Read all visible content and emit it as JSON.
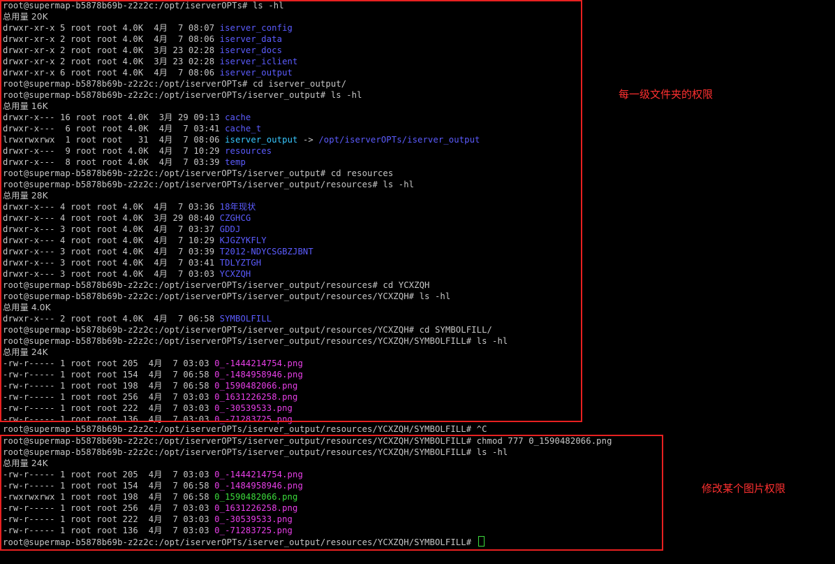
{
  "terminal": {
    "lines": [
      {
        "segs": [
          {
            "t": "root@supermap-b5878b69b-z2z2c:/opt/iserverOPTs# ls -hl"
          }
        ]
      },
      {
        "segs": [
          {
            "t": "总用量 20K",
            "cls": "cjk"
          }
        ]
      },
      {
        "segs": [
          {
            "t": "drwxr-xr-x 5 root root 4.0K  4月  7 08:07 "
          },
          {
            "t": "iserver_config",
            "cls": "dir"
          }
        ]
      },
      {
        "segs": [
          {
            "t": "drwxr-xr-x 2 root root 4.0K  4月  7 08:06 "
          },
          {
            "t": "iserver_data",
            "cls": "dir"
          }
        ]
      },
      {
        "segs": [
          {
            "t": "drwxr-xr-x 2 root root 4.0K  3月 23 02:28 "
          },
          {
            "t": "iserver_docs",
            "cls": "dir"
          }
        ]
      },
      {
        "segs": [
          {
            "t": "drwxr-xr-x 2 root root 4.0K  3月 23 02:28 "
          },
          {
            "t": "iserver_iclient",
            "cls": "dir"
          }
        ]
      },
      {
        "segs": [
          {
            "t": "drwxr-xr-x 6 root root 4.0K  4月  7 08:06 "
          },
          {
            "t": "iserver_output",
            "cls": "dir"
          }
        ]
      },
      {
        "segs": [
          {
            "t": "root@supermap-b5878b69b-z2z2c:/opt/iserverOPTs# cd iserver_output/"
          }
        ]
      },
      {
        "segs": [
          {
            "t": "root@supermap-b5878b69b-z2z2c:/opt/iserverOPTs/iserver_output# ls -hl"
          }
        ]
      },
      {
        "segs": [
          {
            "t": "总用量 16K",
            "cls": "cjk"
          }
        ]
      },
      {
        "segs": [
          {
            "t": "drwxr-x--- 16 root root 4.0K  3月 29 09:13 "
          },
          {
            "t": "cache",
            "cls": "dir"
          }
        ]
      },
      {
        "segs": [
          {
            "t": "drwxr-x---  6 root root 4.0K  4月  7 03:41 "
          },
          {
            "t": "cache_t",
            "cls": "dir"
          }
        ]
      },
      {
        "segs": [
          {
            "t": "lrwxrwxrwx  1 root root   31  4月  7 08:06 "
          },
          {
            "t": "iserver_output",
            "cls": "link"
          },
          {
            "t": " -> "
          },
          {
            "t": "/opt/iserverOPTs/iserver_output",
            "cls": "dir"
          }
        ]
      },
      {
        "segs": [
          {
            "t": "drwxr-x---  9 root root 4.0K  4月  7 10:29 "
          },
          {
            "t": "resources",
            "cls": "dir"
          }
        ]
      },
      {
        "segs": [
          {
            "t": "drwxr-x---  8 root root 4.0K  4月  7 03:39 "
          },
          {
            "t": "temp",
            "cls": "dir"
          }
        ]
      },
      {
        "segs": [
          {
            "t": "root@supermap-b5878b69b-z2z2c:/opt/iserverOPTs/iserver_output# cd resources"
          }
        ]
      },
      {
        "segs": [
          {
            "t": "root@supermap-b5878b69b-z2z2c:/opt/iserverOPTs/iserver_output/resources# ls -hl"
          }
        ]
      },
      {
        "segs": [
          {
            "t": "总用量 28K",
            "cls": "cjk"
          }
        ]
      },
      {
        "segs": [
          {
            "t": "drwxr-x--- 4 root root 4.0K  4月  7 03:36 "
          },
          {
            "t": "18年现状",
            "cls": "dir"
          }
        ]
      },
      {
        "segs": [
          {
            "t": "drwxr-x--- 4 root root 4.0K  3月 29 08:40 "
          },
          {
            "t": "CZGHCG",
            "cls": "dir"
          }
        ]
      },
      {
        "segs": [
          {
            "t": "drwxr-x--- 3 root root 4.0K  4月  7 03:37 "
          },
          {
            "t": "GDDJ",
            "cls": "dir"
          }
        ]
      },
      {
        "segs": [
          {
            "t": "drwxr-x--- 4 root root 4.0K  4月  7 10:29 "
          },
          {
            "t": "KJGZYKFLY",
            "cls": "dir"
          }
        ]
      },
      {
        "segs": [
          {
            "t": "drwxr-x--- 3 root root 4.0K  4月  7 03:39 "
          },
          {
            "t": "T2012-NDYCSGBZJBNT",
            "cls": "dir"
          }
        ]
      },
      {
        "segs": [
          {
            "t": "drwxr-x--- 3 root root 4.0K  4月  7 03:41 "
          },
          {
            "t": "TDLYZTGH",
            "cls": "dir"
          }
        ]
      },
      {
        "segs": [
          {
            "t": "drwxr-x--- 3 root root 4.0K  4月  7 03:03 "
          },
          {
            "t": "YCXZQH",
            "cls": "dir"
          }
        ]
      },
      {
        "segs": [
          {
            "t": "root@supermap-b5878b69b-z2z2c:/opt/iserverOPTs/iserver_output/resources# cd YCXZQH"
          }
        ]
      },
      {
        "segs": [
          {
            "t": "root@supermap-b5878b69b-z2z2c:/opt/iserverOPTs/iserver_output/resources/YCXZQH# ls -hl"
          }
        ]
      },
      {
        "segs": [
          {
            "t": "总用量 4.0K",
            "cls": "cjk"
          }
        ]
      },
      {
        "segs": [
          {
            "t": "drwxr-x--- 2 root root 4.0K  4月  7 06:58 "
          },
          {
            "t": "SYMBOLFILL",
            "cls": "dir"
          }
        ]
      },
      {
        "segs": [
          {
            "t": "root@supermap-b5878b69b-z2z2c:/opt/iserverOPTs/iserver_output/resources/YCXZQH# cd SYMBOLFILL/"
          }
        ]
      },
      {
        "segs": [
          {
            "t": "root@supermap-b5878b69b-z2z2c:/opt/iserverOPTs/iserver_output/resources/YCXZQH/SYMBOLFILL# ls -hl"
          }
        ]
      },
      {
        "segs": [
          {
            "t": "总用量 24K",
            "cls": "cjk"
          }
        ]
      },
      {
        "segs": [
          {
            "t": "-rw-r----- 1 root root 205  4月  7 03:03 "
          },
          {
            "t": "0_-1444214754.png",
            "cls": "pink"
          }
        ]
      },
      {
        "segs": [
          {
            "t": "-rw-r----- 1 root root 154  4月  7 06:58 "
          },
          {
            "t": "0_-1484958946.png",
            "cls": "pink"
          }
        ]
      },
      {
        "segs": [
          {
            "t": "-rw-r----- 1 root root 198  4月  7 06:58 "
          },
          {
            "t": "0_1590482066.png",
            "cls": "pink"
          }
        ]
      },
      {
        "segs": [
          {
            "t": "-rw-r----- 1 root root 256  4月  7 03:03 "
          },
          {
            "t": "0_1631226258.png",
            "cls": "pink"
          }
        ]
      },
      {
        "segs": [
          {
            "t": "-rw-r----- 1 root root 222  4月  7 03:03 "
          },
          {
            "t": "0_-30539533.png",
            "cls": "pink"
          }
        ]
      },
      {
        "segs": [
          {
            "t": "-rw-r----- 1 root root 136  4月  7 03:03 "
          },
          {
            "t": "0_-71283725.png",
            "cls": "pink"
          }
        ]
      },
      {
        "segs": [
          {
            "t": "root@supermap-b5878b69b-z2z2c:/opt/iserverOPTs/iserver_output/resources/YCXZQH/SYMBOLFILL# ^C"
          }
        ]
      },
      {
        "segs": [
          {
            "t": "root@supermap-b5878b69b-z2z2c:/opt/iserverOPTs/iserver_output/resources/YCXZQH/SYMBOLFILL# chmod 777 0_1590482066.png"
          }
        ]
      },
      {
        "segs": [
          {
            "t": "root@supermap-b5878b69b-z2z2c:/opt/iserverOPTs/iserver_output/resources/YCXZQH/SYMBOLFILL# ls -hl"
          }
        ]
      },
      {
        "segs": [
          {
            "t": "总用量 24K",
            "cls": "cjk"
          }
        ]
      },
      {
        "segs": [
          {
            "t": "-rw-r----- 1 root root 205  4月  7 03:03 "
          },
          {
            "t": "0_-1444214754.png",
            "cls": "pink"
          }
        ]
      },
      {
        "segs": [
          {
            "t": "-rw-r----- 1 root root 154  4月  7 06:58 "
          },
          {
            "t": "0_-1484958946.png",
            "cls": "pink"
          }
        ]
      },
      {
        "segs": [
          {
            "t": "-rwxrwxrwx 1 root root 198  4月  7 06:58 "
          },
          {
            "t": "0_1590482066.png",
            "cls": "green"
          }
        ]
      },
      {
        "segs": [
          {
            "t": "-rw-r----- 1 root root 256  4月  7 03:03 "
          },
          {
            "t": "0_1631226258.png",
            "cls": "pink"
          }
        ]
      },
      {
        "segs": [
          {
            "t": "-rw-r----- 1 root root 222  4月  7 03:03 "
          },
          {
            "t": "0_-30539533.png",
            "cls": "pink"
          }
        ]
      },
      {
        "segs": [
          {
            "t": "-rw-r----- 1 root root 136  4月  7 03:03 "
          },
          {
            "t": "0_-71283725.png",
            "cls": "pink"
          }
        ]
      },
      {
        "segs": [
          {
            "t": "root@supermap-b5878b69b-z2z2c:/opt/iserverOPTs/iserver_output/resources/YCXZQH/SYMBOLFILL# "
          }
        ],
        "cursor": true
      }
    ]
  },
  "annotations": {
    "folder_permissions": "每一级文件夹的权限",
    "image_permission": "修改某个图片权限"
  },
  "colors": {
    "background": "#000000",
    "text": "#c7c7c7",
    "directory": "#5c5cff",
    "symlink": "#38c8ff",
    "image_file": "#e83fe8",
    "executable_file": "#3cdc3c",
    "annotation": "#ff3030"
  }
}
